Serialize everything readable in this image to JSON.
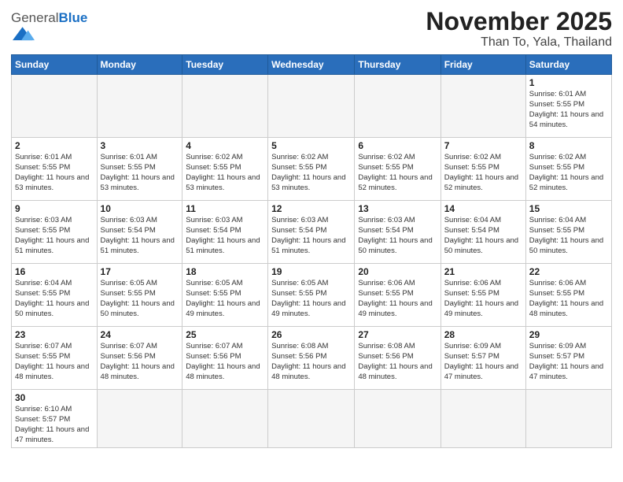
{
  "header": {
    "logo_general": "General",
    "logo_blue": "Blue",
    "month_title": "November 2025",
    "location": "Than To, Yala, Thailand"
  },
  "weekdays": [
    "Sunday",
    "Monday",
    "Tuesday",
    "Wednesday",
    "Thursday",
    "Friday",
    "Saturday"
  ],
  "weeks": [
    [
      {
        "day": "",
        "empty": true
      },
      {
        "day": "",
        "empty": true
      },
      {
        "day": "",
        "empty": true
      },
      {
        "day": "",
        "empty": true
      },
      {
        "day": "",
        "empty": true
      },
      {
        "day": "",
        "empty": true
      },
      {
        "day": "1",
        "sunrise": "Sunrise: 6:01 AM",
        "sunset": "Sunset: 5:55 PM",
        "daylight": "Daylight: 11 hours and 54 minutes."
      }
    ],
    [
      {
        "day": "2",
        "sunrise": "Sunrise: 6:01 AM",
        "sunset": "Sunset: 5:55 PM",
        "daylight": "Daylight: 11 hours and 53 minutes."
      },
      {
        "day": "3",
        "sunrise": "Sunrise: 6:01 AM",
        "sunset": "Sunset: 5:55 PM",
        "daylight": "Daylight: 11 hours and 53 minutes."
      },
      {
        "day": "4",
        "sunrise": "Sunrise: 6:02 AM",
        "sunset": "Sunset: 5:55 PM",
        "daylight": "Daylight: 11 hours and 53 minutes."
      },
      {
        "day": "5",
        "sunrise": "Sunrise: 6:02 AM",
        "sunset": "Sunset: 5:55 PM",
        "daylight": "Daylight: 11 hours and 53 minutes."
      },
      {
        "day": "6",
        "sunrise": "Sunrise: 6:02 AM",
        "sunset": "Sunset: 5:55 PM",
        "daylight": "Daylight: 11 hours and 52 minutes."
      },
      {
        "day": "7",
        "sunrise": "Sunrise: 6:02 AM",
        "sunset": "Sunset: 5:55 PM",
        "daylight": "Daylight: 11 hours and 52 minutes."
      },
      {
        "day": "8",
        "sunrise": "Sunrise: 6:02 AM",
        "sunset": "Sunset: 5:55 PM",
        "daylight": "Daylight: 11 hours and 52 minutes."
      }
    ],
    [
      {
        "day": "9",
        "sunrise": "Sunrise: 6:03 AM",
        "sunset": "Sunset: 5:55 PM",
        "daylight": "Daylight: 11 hours and 51 minutes."
      },
      {
        "day": "10",
        "sunrise": "Sunrise: 6:03 AM",
        "sunset": "Sunset: 5:54 PM",
        "daylight": "Daylight: 11 hours and 51 minutes."
      },
      {
        "day": "11",
        "sunrise": "Sunrise: 6:03 AM",
        "sunset": "Sunset: 5:54 PM",
        "daylight": "Daylight: 11 hours and 51 minutes."
      },
      {
        "day": "12",
        "sunrise": "Sunrise: 6:03 AM",
        "sunset": "Sunset: 5:54 PM",
        "daylight": "Daylight: 11 hours and 51 minutes."
      },
      {
        "day": "13",
        "sunrise": "Sunrise: 6:03 AM",
        "sunset": "Sunset: 5:54 PM",
        "daylight": "Daylight: 11 hours and 50 minutes."
      },
      {
        "day": "14",
        "sunrise": "Sunrise: 6:04 AM",
        "sunset": "Sunset: 5:54 PM",
        "daylight": "Daylight: 11 hours and 50 minutes."
      },
      {
        "day": "15",
        "sunrise": "Sunrise: 6:04 AM",
        "sunset": "Sunset: 5:55 PM",
        "daylight": "Daylight: 11 hours and 50 minutes."
      }
    ],
    [
      {
        "day": "16",
        "sunrise": "Sunrise: 6:04 AM",
        "sunset": "Sunset: 5:55 PM",
        "daylight": "Daylight: 11 hours and 50 minutes."
      },
      {
        "day": "17",
        "sunrise": "Sunrise: 6:05 AM",
        "sunset": "Sunset: 5:55 PM",
        "daylight": "Daylight: 11 hours and 50 minutes."
      },
      {
        "day": "18",
        "sunrise": "Sunrise: 6:05 AM",
        "sunset": "Sunset: 5:55 PM",
        "daylight": "Daylight: 11 hours and 49 minutes."
      },
      {
        "day": "19",
        "sunrise": "Sunrise: 6:05 AM",
        "sunset": "Sunset: 5:55 PM",
        "daylight": "Daylight: 11 hours and 49 minutes."
      },
      {
        "day": "20",
        "sunrise": "Sunrise: 6:06 AM",
        "sunset": "Sunset: 5:55 PM",
        "daylight": "Daylight: 11 hours and 49 minutes."
      },
      {
        "day": "21",
        "sunrise": "Sunrise: 6:06 AM",
        "sunset": "Sunset: 5:55 PM",
        "daylight": "Daylight: 11 hours and 49 minutes."
      },
      {
        "day": "22",
        "sunrise": "Sunrise: 6:06 AM",
        "sunset": "Sunset: 5:55 PM",
        "daylight": "Daylight: 11 hours and 48 minutes."
      }
    ],
    [
      {
        "day": "23",
        "sunrise": "Sunrise: 6:07 AM",
        "sunset": "Sunset: 5:55 PM",
        "daylight": "Daylight: 11 hours and 48 minutes."
      },
      {
        "day": "24",
        "sunrise": "Sunrise: 6:07 AM",
        "sunset": "Sunset: 5:56 PM",
        "daylight": "Daylight: 11 hours and 48 minutes."
      },
      {
        "day": "25",
        "sunrise": "Sunrise: 6:07 AM",
        "sunset": "Sunset: 5:56 PM",
        "daylight": "Daylight: 11 hours and 48 minutes."
      },
      {
        "day": "26",
        "sunrise": "Sunrise: 6:08 AM",
        "sunset": "Sunset: 5:56 PM",
        "daylight": "Daylight: 11 hours and 48 minutes."
      },
      {
        "day": "27",
        "sunrise": "Sunrise: 6:08 AM",
        "sunset": "Sunset: 5:56 PM",
        "daylight": "Daylight: 11 hours and 48 minutes."
      },
      {
        "day": "28",
        "sunrise": "Sunrise: 6:09 AM",
        "sunset": "Sunset: 5:57 PM",
        "daylight": "Daylight: 11 hours and 47 minutes."
      },
      {
        "day": "29",
        "sunrise": "Sunrise: 6:09 AM",
        "sunset": "Sunset: 5:57 PM",
        "daylight": "Daylight: 11 hours and 47 minutes."
      }
    ],
    [
      {
        "day": "30",
        "sunrise": "Sunrise: 6:10 AM",
        "sunset": "Sunset: 5:57 PM",
        "daylight": "Daylight: 11 hours and 47 minutes."
      },
      {
        "day": "",
        "empty": true
      },
      {
        "day": "",
        "empty": true
      },
      {
        "day": "",
        "empty": true
      },
      {
        "day": "",
        "empty": true
      },
      {
        "day": "",
        "empty": true
      },
      {
        "day": "",
        "empty": true
      }
    ]
  ]
}
